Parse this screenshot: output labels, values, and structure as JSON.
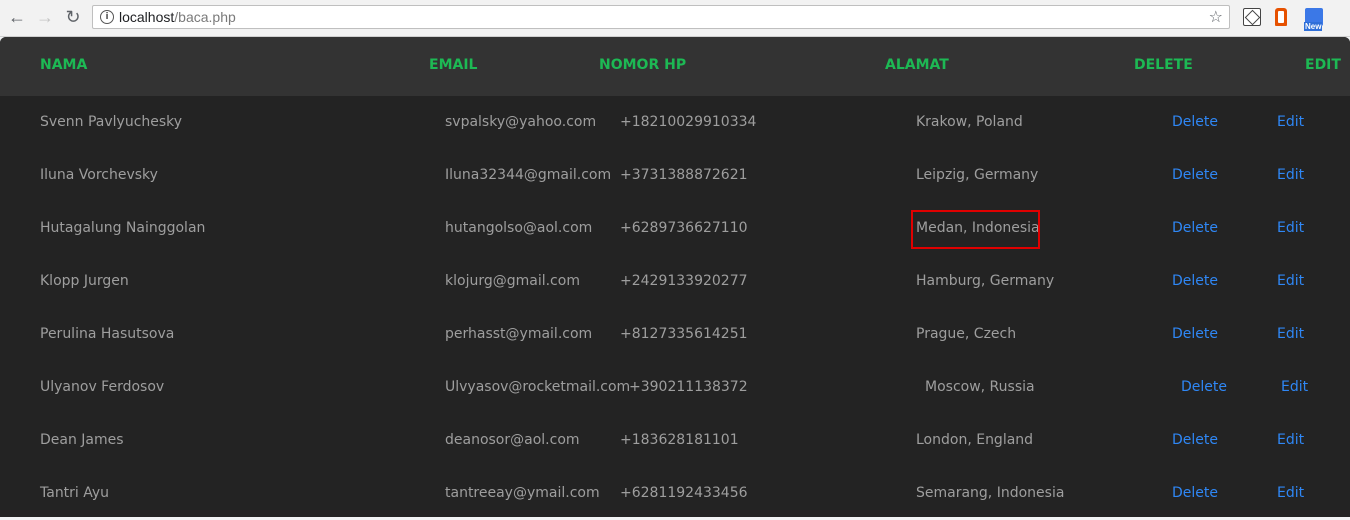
{
  "browser": {
    "url_host": "localhost",
    "url_path": "/baca.php",
    "ext_badge": "New"
  },
  "table": {
    "headers": {
      "nama": "NAMA",
      "email": "EMAIL",
      "nomor_hp": "NOMOR HP",
      "alamat": "ALAMAT",
      "delete": "DELETE",
      "edit": "EDIT"
    },
    "rows": [
      {
        "nama": "Svenn Pavlyuchesky",
        "email": "svpalsky@yahoo.com",
        "hp": "+18210029910334",
        "alamat": "Krakow, Poland",
        "delete": "Delete",
        "edit": "Edit"
      },
      {
        "nama": "Iluna Vorchevsky",
        "email": "Iluna32344@gmail.com",
        "hp": "+3731388872621",
        "alamat": "Leipzig, Germany",
        "delete": "Delete",
        "edit": "Edit"
      },
      {
        "nama": "Hutagalung Nainggolan",
        "email": "hutangolso@aol.com",
        "hp": "+6289736627110",
        "alamat": "Medan, Indonesia",
        "delete": "Delete",
        "edit": "Edit"
      },
      {
        "nama": "Klopp Jurgen",
        "email": "klojurg@gmail.com",
        "hp": "+2429133920277",
        "alamat": "Hamburg, Germany",
        "delete": "Delete",
        "edit": "Edit"
      },
      {
        "nama": "Perulina Hasutsova",
        "email": "perhasst@ymail.com",
        "hp": "+8127335614251",
        "alamat": "Prague, Czech",
        "delete": "Delete",
        "edit": "Edit"
      },
      {
        "nama": "Ulyanov Ferdosov",
        "email": "Ulvyasov@rocketmail.com",
        "hp": "+390211138372",
        "alamat": "Moscow, Russia",
        "delete": "Delete",
        "edit": "Edit"
      },
      {
        "nama": "Dean James",
        "email": "deanosor@aol.com",
        "hp": "+183628181101",
        "alamat": "London, England",
        "delete": "Delete",
        "edit": "Edit"
      },
      {
        "nama": "Tantri Ayu",
        "email": "tantreeay@ymail.com",
        "hp": "+6281192433456",
        "alamat": "Semarang, Indonesia",
        "delete": "Delete",
        "edit": "Edit"
      }
    ]
  },
  "colors": {
    "header_text": "#1db954",
    "link": "#2f87f5",
    "highlight": "#e00000"
  }
}
